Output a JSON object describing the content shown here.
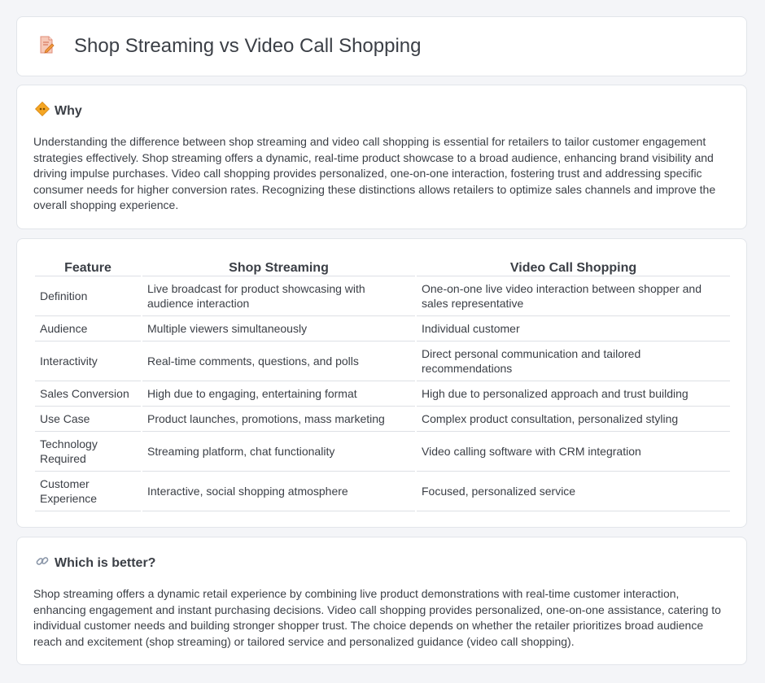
{
  "header": {
    "title": "Shop Streaming vs Video Call Shopping",
    "icon": "document-pencil-icon"
  },
  "why": {
    "title": "Why",
    "icon": "diamond-sign-icon",
    "text": "Understanding the difference between shop streaming and video call shopping is essential for retailers to tailor customer engagement strategies effectively. Shop streaming offers a dynamic, real-time product showcase to a broad audience, enhancing brand visibility and driving impulse purchases. Video call shopping provides personalized, one-on-one interaction, fostering trust and addressing specific consumer needs for higher conversion rates. Recognizing these distinctions allows retailers to optimize sales channels and improve the overall shopping experience."
  },
  "table": {
    "headers": [
      "Feature",
      "Shop Streaming",
      "Video Call Shopping"
    ],
    "rows": [
      [
        "Definition",
        "Live broadcast for product showcasing with audience interaction",
        "One-on-one live video interaction between shopper and sales representative"
      ],
      [
        "Audience",
        "Multiple viewers simultaneously",
        "Individual customer"
      ],
      [
        "Interactivity",
        "Real-time comments, questions, and polls",
        "Direct personal communication and tailored recommendations"
      ],
      [
        "Sales Conversion",
        "High due to engaging, entertaining format",
        "High due to personalized approach and trust building"
      ],
      [
        "Use Case",
        "Product launches, promotions, mass marketing",
        "Complex product consultation, personalized styling"
      ],
      [
        "Technology Required",
        "Streaming platform, chat functionality",
        "Video calling software with CRM integration"
      ],
      [
        "Customer Experience",
        "Interactive, social shopping atmosphere",
        "Focused, personalized service"
      ]
    ]
  },
  "better": {
    "title": "Which is better?",
    "icon": "link-icon",
    "text": "Shop streaming offers a dynamic retail experience by combining live product demonstrations with real-time customer interaction, enhancing engagement and instant purchasing decisions. Video call shopping provides personalized, one-on-one assistance, catering to individual customer needs and building stronger shopper trust. The choice depends on whether the retailer prioritizes broad audience reach and excitement (shop streaming) or tailored service and personalized guidance (video call shopping)."
  }
}
